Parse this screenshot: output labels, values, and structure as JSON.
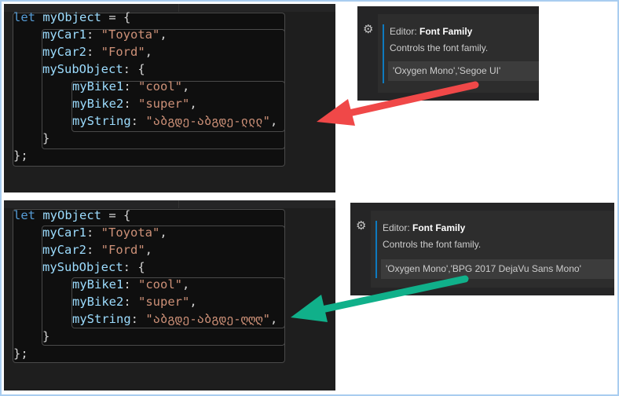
{
  "panels": [
    {
      "code": {
        "l1": {
          "kw": "let",
          "name": " myObject",
          "rest": " = {"
        },
        "l2": {
          "prop": "myCar1",
          "sep": ": ",
          "str": "\"Toyota\"",
          "end": ","
        },
        "l3": {
          "prop": "myCar2",
          "sep": ": ",
          "str": "\"Ford\"",
          "end": ","
        },
        "l4": {
          "prop": "mySubObject",
          "sep": ": {"
        },
        "l5": {
          "prop": "myBike1",
          "sep": ": ",
          "str": "\"cool\"",
          "end": ","
        },
        "l6": {
          "prop": "myBike2",
          "sep": ": ",
          "str": "\"super\"",
          "end": ","
        },
        "l7": {
          "prop": "myString",
          "sep": ": ",
          "str": "\"აბგდე-აბგდე-ლლლ\"",
          "end": ","
        },
        "l8": "}",
        "l9": "};"
      },
      "setting": {
        "category": "Editor: ",
        "name": "Font Family",
        "description": "Controls the font family.",
        "value": "'Oxygen Mono','Segoe UI'"
      },
      "arrow_color": "#f04848"
    },
    {
      "code": {
        "l1": {
          "kw": "let",
          "name": " myObject",
          "rest": " = {"
        },
        "l2": {
          "prop": "myCar1",
          "sep": ": ",
          "str": "\"Toyota\"",
          "end": ","
        },
        "l3": {
          "prop": "myCar2",
          "sep": ": ",
          "str": "\"Ford\"",
          "end": ","
        },
        "l4": {
          "prop": "mySubObject",
          "sep": ": {"
        },
        "l5": {
          "prop": "myBike1",
          "sep": ": ",
          "str": "\"cool\"",
          "end": ","
        },
        "l6": {
          "prop": "myBike2",
          "sep": ": ",
          "str": "\"super\"",
          "end": ","
        },
        "l7": {
          "prop": "myString",
          "sep": ": ",
          "str": "\"აბგდე-აბგდე-ღღღ\"",
          "end": ","
        },
        "l8": "}",
        "l9": "};"
      },
      "setting": {
        "category": "Editor: ",
        "name": "Font Family",
        "description": "Controls the font family.",
        "value": "'Oxygen Mono','BPG 2017 DejaVu Sans Mono'"
      },
      "arrow_color": "#10b08a"
    }
  ]
}
